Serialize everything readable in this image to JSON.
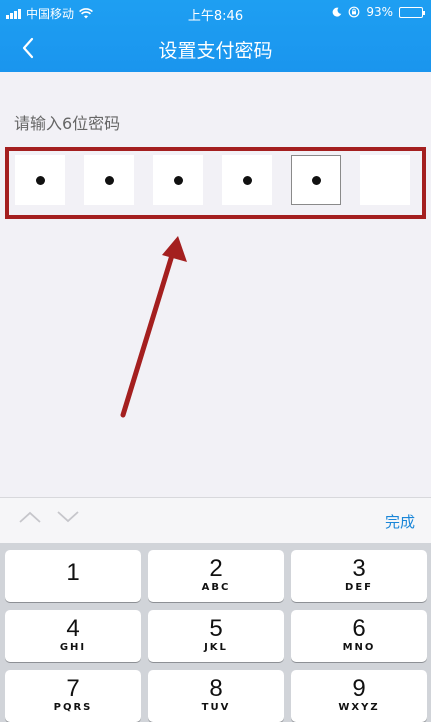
{
  "status_bar": {
    "carrier": "中国移动",
    "time": "上午8:46",
    "battery_percent": "93%",
    "battery_level": 0.93,
    "icons": [
      "signal-icon",
      "wifi-icon",
      "moon-icon",
      "rotation-lock-icon",
      "battery-icon"
    ]
  },
  "nav": {
    "title": "设置支付密码",
    "back_icon": "chevron-left-icon"
  },
  "prompt": "请输入6位密码",
  "password": {
    "length": 6,
    "filled": 5,
    "active_index": 4
  },
  "annotation": {
    "frame_color": "#a41f1f",
    "arrow_color": "#a41f1f"
  },
  "keyboard_toolbar": {
    "done_label": "完成",
    "prev_icon": "chevron-up-icon",
    "next_icon": "chevron-down-icon"
  },
  "keypad": [
    {
      "num": "1",
      "letters": ""
    },
    {
      "num": "2",
      "letters": "ABC"
    },
    {
      "num": "3",
      "letters": "DEF"
    },
    {
      "num": "4",
      "letters": "GHI"
    },
    {
      "num": "5",
      "letters": "JKL"
    },
    {
      "num": "6",
      "letters": "MNO"
    },
    {
      "num": "7",
      "letters": "PQRS"
    },
    {
      "num": "8",
      "letters": "TUV"
    },
    {
      "num": "9",
      "letters": "WXYZ"
    }
  ],
  "colors": {
    "brand_blue": "#1a95ee",
    "link_blue": "#1a86d8"
  }
}
